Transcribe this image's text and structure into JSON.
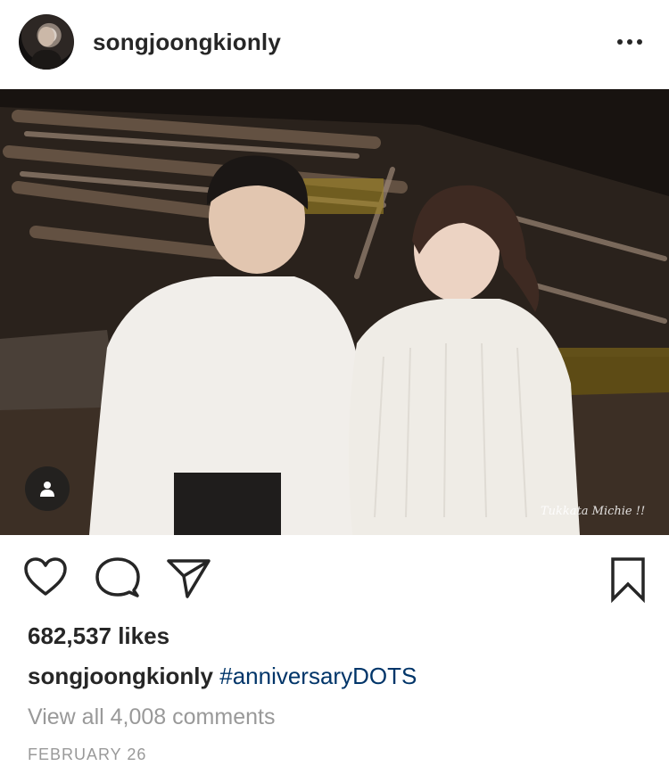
{
  "post": {
    "username": "songjoongkionly",
    "photo_watermark": "Tukkata Michie !!",
    "likes": "682,537 likes",
    "caption": {
      "username": "songjoongkionly",
      "hashtag": "#anniversaryDOTS"
    },
    "view_all_comments": "View all 4,008 comments",
    "date": "FEBRUARY 26"
  },
  "icons": {
    "more": "more-options-icon",
    "tag": "user-tag-icon",
    "like": "heart-icon",
    "comment": "comment-icon",
    "share": "share-icon",
    "save": "bookmark-icon"
  },
  "colors": {
    "text": "#262626",
    "hashtag": "#003569",
    "muted": "#999999"
  }
}
